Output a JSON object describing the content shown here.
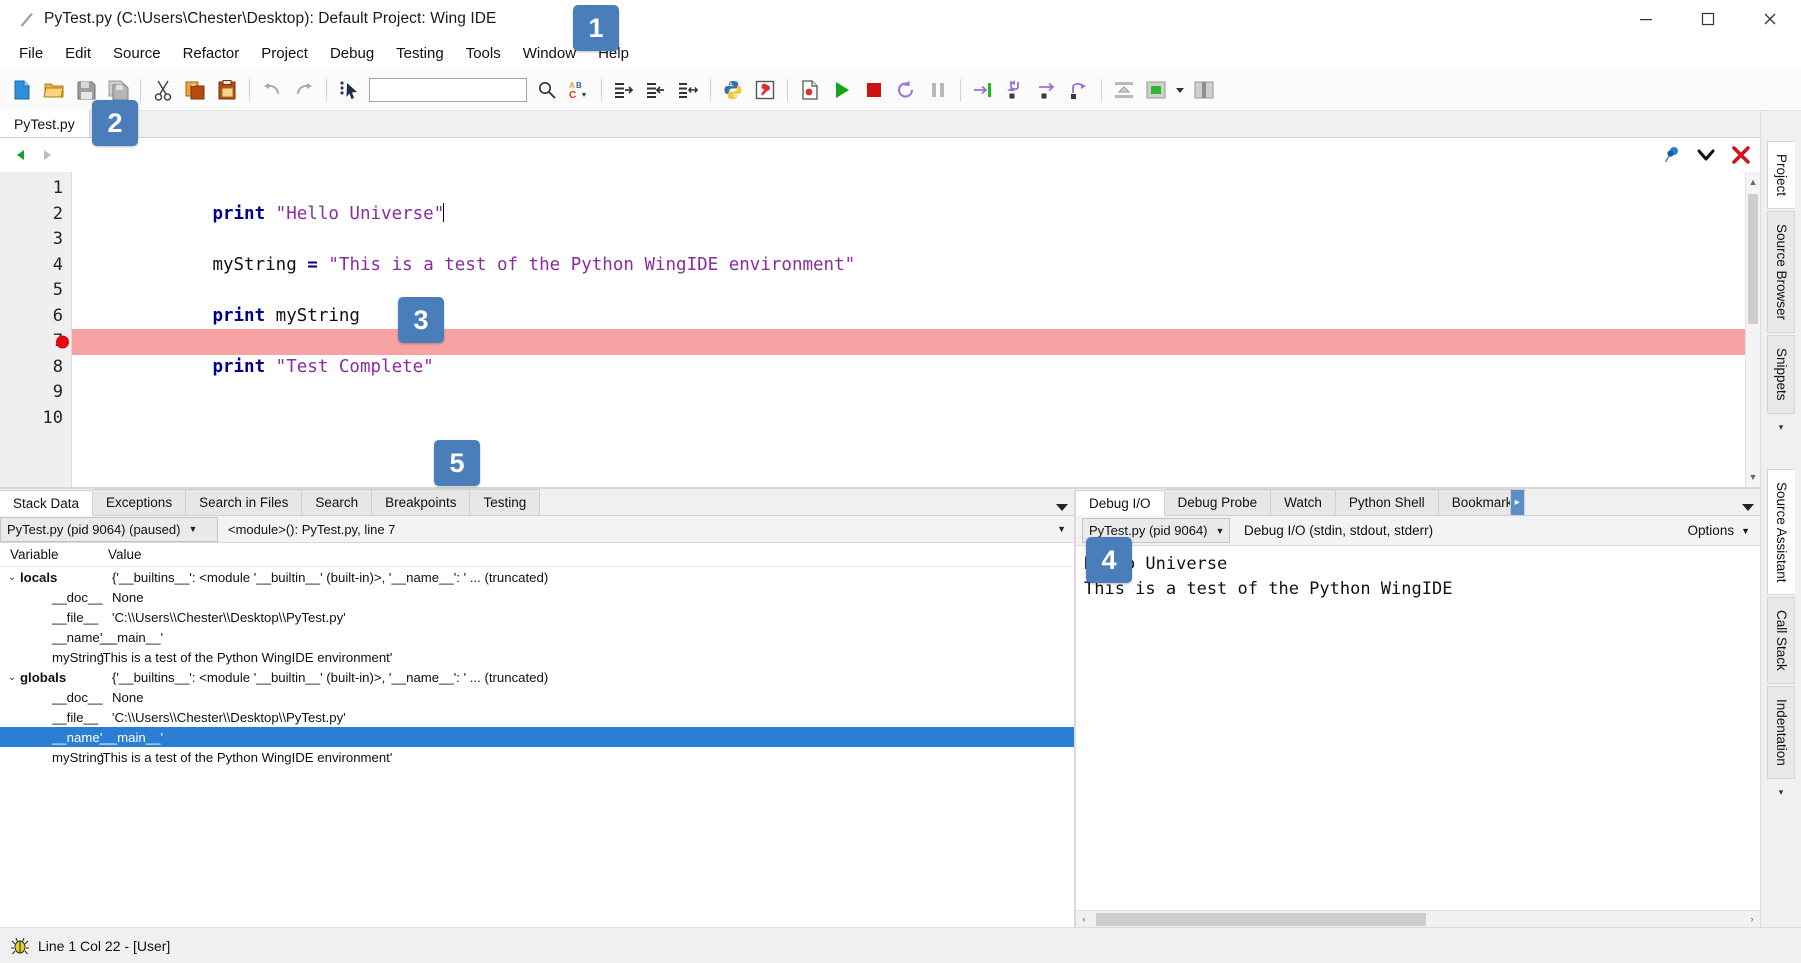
{
  "window": {
    "title": "PyTest.py (C:\\Users\\Chester\\Desktop): Default Project: Wing IDE",
    "minimize": "─",
    "maximize": "☐",
    "close": "✕"
  },
  "menubar": {
    "items": [
      {
        "label": "File"
      },
      {
        "label": "Edit"
      },
      {
        "label": "Source"
      },
      {
        "label": "Refactor"
      },
      {
        "label": "Project"
      },
      {
        "label": "Debug"
      },
      {
        "label": "Testing"
      },
      {
        "label": "Tools"
      },
      {
        "label": "Window"
      },
      {
        "label": "Help"
      }
    ]
  },
  "toolbar": {
    "search_placeholder": "",
    "search_value": "",
    "buttons": [
      {
        "name": "new-file-icon",
        "title": "New File"
      },
      {
        "name": "open-file-icon",
        "title": "Open File"
      },
      {
        "name": "save-file-icon",
        "title": "Save File"
      },
      {
        "name": "save-all-icon",
        "title": "Save All"
      },
      {
        "name": "cut-icon",
        "title": "Cut"
      },
      {
        "name": "copy-icon",
        "title": "Copy"
      },
      {
        "name": "paste-icon",
        "title": "Paste"
      },
      {
        "name": "undo-icon",
        "title": "Undo"
      },
      {
        "name": "redo-icon",
        "title": "Redo"
      },
      {
        "name": "goto-definition-icon",
        "title": "Goto Selected Symbol"
      },
      {
        "name": "search-icon",
        "title": "Search"
      },
      {
        "name": "replace-icon",
        "title": "Search and Replace"
      },
      {
        "name": "indent-right-icon",
        "title": "Indent Right"
      },
      {
        "name": "indent-left-icon",
        "title": "Indent Left"
      },
      {
        "name": "indent-match-icon",
        "title": "Match Indent"
      },
      {
        "name": "python-shell-icon",
        "title": "Python Shell"
      },
      {
        "name": "debug-probe-icon",
        "title": "Debug Probe"
      },
      {
        "name": "debug-file-icon",
        "title": "Debug Current File"
      },
      {
        "name": "run-icon",
        "title": "Start / Continue"
      },
      {
        "name": "stop-icon",
        "title": "Stop Debugging"
      },
      {
        "name": "restart-icon",
        "title": "Restart Debugging"
      },
      {
        "name": "pause-icon",
        "title": "Pause"
      },
      {
        "name": "run-to-cursor-icon",
        "title": "Run to Cursor"
      },
      {
        "name": "step-into-icon",
        "title": "Step Into"
      },
      {
        "name": "step-over-icon",
        "title": "Step Over"
      },
      {
        "name": "step-out-icon",
        "title": "Step Out"
      },
      {
        "name": "show-toolbox-icon",
        "title": "Toolbox"
      },
      {
        "name": "panel-layout-icon",
        "title": "Panel Layout"
      },
      {
        "name": "panel-layout-dropdown-icon",
        "title": "Panel Layout Options"
      },
      {
        "name": "split-panels-icon",
        "title": "Split Panels"
      }
    ]
  },
  "editor": {
    "tabs": [
      {
        "label": "PyTest.py",
        "active": true
      }
    ],
    "nav": {
      "back": "◀",
      "forward": "▶"
    },
    "right_icons": [
      {
        "name": "pin-icon"
      },
      {
        "name": "chevron-down-icon"
      },
      {
        "name": "close-editor-icon"
      }
    ],
    "lines": [
      {
        "number": "1",
        "breakpoint": false,
        "current": false,
        "tokens": [
          {
            "t": "kw",
            "v": "print"
          },
          {
            "t": "plain",
            "v": " "
          },
          {
            "t": "str",
            "v": "\"Hello Universe\""
          },
          {
            "t": "caret",
            "v": ""
          }
        ]
      },
      {
        "number": "2",
        "breakpoint": false,
        "current": false,
        "tokens": []
      },
      {
        "number": "3",
        "breakpoint": false,
        "current": false,
        "tokens": [
          {
            "t": "id",
            "v": "myString"
          },
          {
            "t": "plain",
            "v": " "
          },
          {
            "t": "op",
            "v": "="
          },
          {
            "t": "plain",
            "v": " "
          },
          {
            "t": "str",
            "v": "\"This is a test of the Python WingIDE environment\""
          }
        ]
      },
      {
        "number": "4",
        "breakpoint": false,
        "current": false,
        "tokens": []
      },
      {
        "number": "5",
        "breakpoint": false,
        "current": false,
        "tokens": [
          {
            "t": "kw",
            "v": "print"
          },
          {
            "t": "plain",
            "v": " "
          },
          {
            "t": "id",
            "v": "myString"
          }
        ]
      },
      {
        "number": "6",
        "breakpoint": false,
        "current": false,
        "tokens": []
      },
      {
        "number": "7",
        "breakpoint": true,
        "current": true,
        "tokens": [
          {
            "t": "kw",
            "v": "print"
          },
          {
            "t": "plain",
            "v": " "
          },
          {
            "t": "str",
            "v": "\"Test Complete\""
          }
        ]
      },
      {
        "number": "8",
        "breakpoint": false,
        "current": false,
        "tokens": []
      },
      {
        "number": "9",
        "breakpoint": false,
        "current": false,
        "tokens": []
      },
      {
        "number": "10",
        "breakpoint": false,
        "current": false,
        "tokens": []
      }
    ]
  },
  "stack_panel": {
    "tabs": [
      {
        "label": "Stack Data",
        "active": true
      },
      {
        "label": "Exceptions",
        "active": false
      },
      {
        "label": "Search in Files",
        "active": false
      },
      {
        "label": "Search",
        "active": false
      },
      {
        "label": "Breakpoints",
        "active": false
      },
      {
        "label": "Testing",
        "active": false
      }
    ],
    "process_combo": "PyTest.py (pid 9064) (paused)",
    "frame_combo": "<module>(): PyTest.py, line 7",
    "columns": {
      "variable": "Variable",
      "value": "Value"
    },
    "rows": [
      {
        "indent": 0,
        "twisty": "⌄",
        "bold": true,
        "selected": false,
        "name": "locals",
        "value": "{'__builtins__': <module '__builtin__' (built-in)>, '__name__': ' ... (truncated)"
      },
      {
        "indent": 1,
        "twisty": "",
        "bold": false,
        "selected": false,
        "name": "__doc__",
        "value": "None"
      },
      {
        "indent": 1,
        "twisty": "",
        "bold": false,
        "selected": false,
        "name": "__file__",
        "value": "'C:\\\\Users\\\\Chester\\\\Desktop\\\\PyTest.py'"
      },
      {
        "indent": 1,
        "twisty": "",
        "bold": false,
        "selected": false,
        "name": "__name__",
        "value": "'__main__'"
      },
      {
        "indent": 1,
        "twisty": "",
        "bold": false,
        "selected": false,
        "name": "myString",
        "value": "'This is a test of the Python WingIDE environment'"
      },
      {
        "indent": 0,
        "twisty": "⌄",
        "bold": true,
        "selected": false,
        "name": "globals",
        "value": "{'__builtins__': <module '__builtin__' (built-in)>, '__name__': ' ... (truncated)"
      },
      {
        "indent": 1,
        "twisty": "",
        "bold": false,
        "selected": false,
        "name": "__doc__",
        "value": "None"
      },
      {
        "indent": 1,
        "twisty": "",
        "bold": false,
        "selected": false,
        "name": "__file__",
        "value": "'C:\\\\Users\\\\Chester\\\\Desktop\\\\PyTest.py'"
      },
      {
        "indent": 1,
        "twisty": "",
        "bold": false,
        "selected": true,
        "name": "__name__",
        "value": "'__main__'"
      },
      {
        "indent": 1,
        "twisty": "",
        "bold": false,
        "selected": false,
        "name": "myString",
        "value": "'This is a test of the Python WingIDE environment'"
      }
    ]
  },
  "debug_io_panel": {
    "tabs": [
      {
        "label": "Debug I/O",
        "active": true
      },
      {
        "label": "Debug Probe",
        "active": false
      },
      {
        "label": "Watch",
        "active": false
      },
      {
        "label": "Python Shell",
        "active": false
      },
      {
        "label": "Bookmarks",
        "active": false
      }
    ],
    "tabs_overflow": "▸",
    "tabs_menu": "▾",
    "process_combo": "PyTest.py (pid 9064)",
    "stream_label": "Debug I/O (stdin, stdout, stderr)",
    "options_label": "Options",
    "output_lines": [
      "Hello Universe",
      "This is a test of the Python WingIDE"
    ],
    "hscroll_left": "‹",
    "hscroll_right": "›"
  },
  "rail": {
    "top_tabs": [
      {
        "label": "Project",
        "active": true
      },
      {
        "label": "Source Browser",
        "active": false
      },
      {
        "label": "Snippets",
        "active": false
      }
    ],
    "top_arrow": "▾",
    "bottom_tabs": [
      {
        "label": "Source Assistant",
        "active": true
      },
      {
        "label": "Call Stack",
        "active": false
      },
      {
        "label": "Indentation",
        "active": false
      }
    ],
    "bottom_arrow": "▾"
  },
  "statusbar": {
    "icon": "bug-icon",
    "text": "Line 1 Col 22 - [User]"
  },
  "callouts": [
    {
      "id": "1",
      "label": "1"
    },
    {
      "id": "2",
      "label": "2"
    },
    {
      "id": "3",
      "label": "3"
    },
    {
      "id": "4",
      "label": "4"
    },
    {
      "id": "5",
      "label": "5"
    }
  ],
  "colors": {
    "accent_badge": "#4a7ebb",
    "selection": "#2a7fd4",
    "current_line": "#f7a3a3",
    "breakpoint": "#e8070c",
    "keyword": "#00008f",
    "string": "#8a2ca0"
  }
}
